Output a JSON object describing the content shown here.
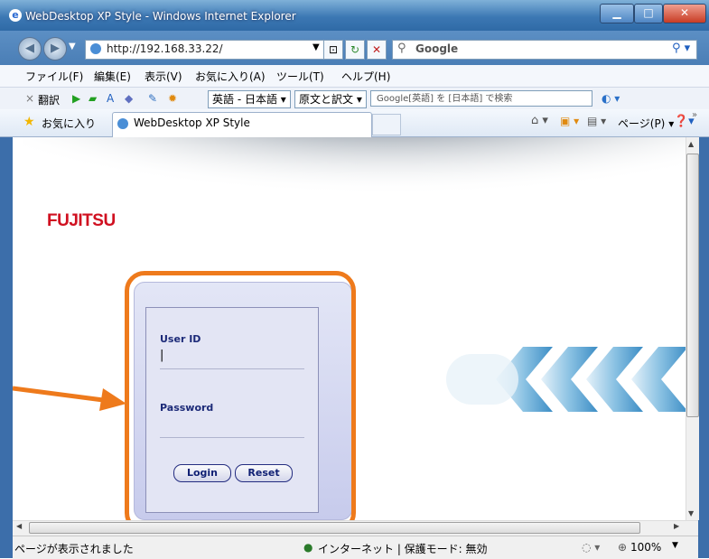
{
  "window": {
    "title": "WebDesktop XP Style - Windows Internet Explorer"
  },
  "address_bar": {
    "url": "http://192.168.33.22/",
    "search_placeholder": "Google"
  },
  "menu": [
    "ファイル(F)",
    "編集(E)",
    "表示(V)",
    "お気に入り(A)",
    "ツール(T)",
    "ヘルプ(H)"
  ],
  "translate_bar": {
    "close": "×",
    "label": "翻訳",
    "lang_pair": "英語 - 日本語",
    "mode": "原文と訳文",
    "search_hint": "Google[英語] を [日本語] で検索"
  },
  "favorites_bar": {
    "favorites": "お気に入り",
    "tab_title": "WebDesktop XP Style",
    "page_menu": "ページ(P)"
  },
  "page": {
    "logo": "FUJITSU",
    "login": {
      "user_id_label": "User ID",
      "password_label": "Password",
      "login_button": "Login",
      "reset_button": "Reset",
      "cursor": "|"
    }
  },
  "status_bar": {
    "message": "ページが表示されました",
    "zone": "インターネット | 保護モード: 無効",
    "zoom": "100%"
  },
  "colors": {
    "highlight": "#ee7a1c",
    "login_text": "#1c2a78"
  }
}
